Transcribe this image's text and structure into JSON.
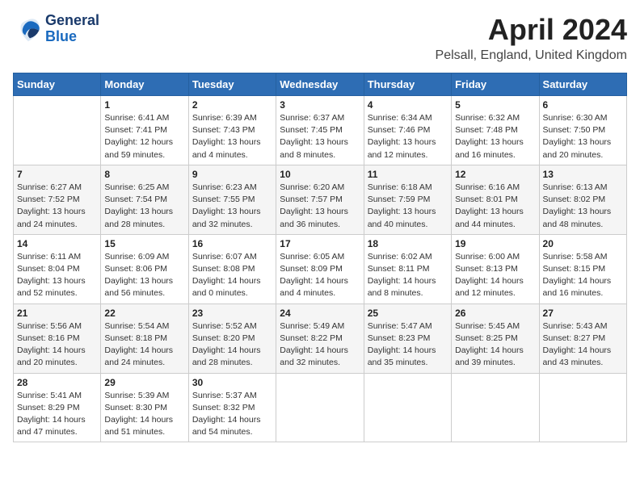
{
  "header": {
    "logo_general": "General",
    "logo_blue": "Blue",
    "title": "April 2024",
    "subtitle": "Pelsall, England, United Kingdom"
  },
  "columns": [
    "Sunday",
    "Monday",
    "Tuesday",
    "Wednesday",
    "Thursday",
    "Friday",
    "Saturday"
  ],
  "weeks": [
    [
      {
        "num": "",
        "info": ""
      },
      {
        "num": "1",
        "info": "Sunrise: 6:41 AM\nSunset: 7:41 PM\nDaylight: 12 hours\nand 59 minutes."
      },
      {
        "num": "2",
        "info": "Sunrise: 6:39 AM\nSunset: 7:43 PM\nDaylight: 13 hours\nand 4 minutes."
      },
      {
        "num": "3",
        "info": "Sunrise: 6:37 AM\nSunset: 7:45 PM\nDaylight: 13 hours\nand 8 minutes."
      },
      {
        "num": "4",
        "info": "Sunrise: 6:34 AM\nSunset: 7:46 PM\nDaylight: 13 hours\nand 12 minutes."
      },
      {
        "num": "5",
        "info": "Sunrise: 6:32 AM\nSunset: 7:48 PM\nDaylight: 13 hours\nand 16 minutes."
      },
      {
        "num": "6",
        "info": "Sunrise: 6:30 AM\nSunset: 7:50 PM\nDaylight: 13 hours\nand 20 minutes."
      }
    ],
    [
      {
        "num": "7",
        "info": "Sunrise: 6:27 AM\nSunset: 7:52 PM\nDaylight: 13 hours\nand 24 minutes."
      },
      {
        "num": "8",
        "info": "Sunrise: 6:25 AM\nSunset: 7:54 PM\nDaylight: 13 hours\nand 28 minutes."
      },
      {
        "num": "9",
        "info": "Sunrise: 6:23 AM\nSunset: 7:55 PM\nDaylight: 13 hours\nand 32 minutes."
      },
      {
        "num": "10",
        "info": "Sunrise: 6:20 AM\nSunset: 7:57 PM\nDaylight: 13 hours\nand 36 minutes."
      },
      {
        "num": "11",
        "info": "Sunrise: 6:18 AM\nSunset: 7:59 PM\nDaylight: 13 hours\nand 40 minutes."
      },
      {
        "num": "12",
        "info": "Sunrise: 6:16 AM\nSunset: 8:01 PM\nDaylight: 13 hours\nand 44 minutes."
      },
      {
        "num": "13",
        "info": "Sunrise: 6:13 AM\nSunset: 8:02 PM\nDaylight: 13 hours\nand 48 minutes."
      }
    ],
    [
      {
        "num": "14",
        "info": "Sunrise: 6:11 AM\nSunset: 8:04 PM\nDaylight: 13 hours\nand 52 minutes."
      },
      {
        "num": "15",
        "info": "Sunrise: 6:09 AM\nSunset: 8:06 PM\nDaylight: 13 hours\nand 56 minutes."
      },
      {
        "num": "16",
        "info": "Sunrise: 6:07 AM\nSunset: 8:08 PM\nDaylight: 14 hours\nand 0 minutes."
      },
      {
        "num": "17",
        "info": "Sunrise: 6:05 AM\nSunset: 8:09 PM\nDaylight: 14 hours\nand 4 minutes."
      },
      {
        "num": "18",
        "info": "Sunrise: 6:02 AM\nSunset: 8:11 PM\nDaylight: 14 hours\nand 8 minutes."
      },
      {
        "num": "19",
        "info": "Sunrise: 6:00 AM\nSunset: 8:13 PM\nDaylight: 14 hours\nand 12 minutes."
      },
      {
        "num": "20",
        "info": "Sunrise: 5:58 AM\nSunset: 8:15 PM\nDaylight: 14 hours\nand 16 minutes."
      }
    ],
    [
      {
        "num": "21",
        "info": "Sunrise: 5:56 AM\nSunset: 8:16 PM\nDaylight: 14 hours\nand 20 minutes."
      },
      {
        "num": "22",
        "info": "Sunrise: 5:54 AM\nSunset: 8:18 PM\nDaylight: 14 hours\nand 24 minutes."
      },
      {
        "num": "23",
        "info": "Sunrise: 5:52 AM\nSunset: 8:20 PM\nDaylight: 14 hours\nand 28 minutes."
      },
      {
        "num": "24",
        "info": "Sunrise: 5:49 AM\nSunset: 8:22 PM\nDaylight: 14 hours\nand 32 minutes."
      },
      {
        "num": "25",
        "info": "Sunrise: 5:47 AM\nSunset: 8:23 PM\nDaylight: 14 hours\nand 35 minutes."
      },
      {
        "num": "26",
        "info": "Sunrise: 5:45 AM\nSunset: 8:25 PM\nDaylight: 14 hours\nand 39 minutes."
      },
      {
        "num": "27",
        "info": "Sunrise: 5:43 AM\nSunset: 8:27 PM\nDaylight: 14 hours\nand 43 minutes."
      }
    ],
    [
      {
        "num": "28",
        "info": "Sunrise: 5:41 AM\nSunset: 8:29 PM\nDaylight: 14 hours\nand 47 minutes."
      },
      {
        "num": "29",
        "info": "Sunrise: 5:39 AM\nSunset: 8:30 PM\nDaylight: 14 hours\nand 51 minutes."
      },
      {
        "num": "30",
        "info": "Sunrise: 5:37 AM\nSunset: 8:32 PM\nDaylight: 14 hours\nand 54 minutes."
      },
      {
        "num": "",
        "info": ""
      },
      {
        "num": "",
        "info": ""
      },
      {
        "num": "",
        "info": ""
      },
      {
        "num": "",
        "info": ""
      }
    ]
  ]
}
